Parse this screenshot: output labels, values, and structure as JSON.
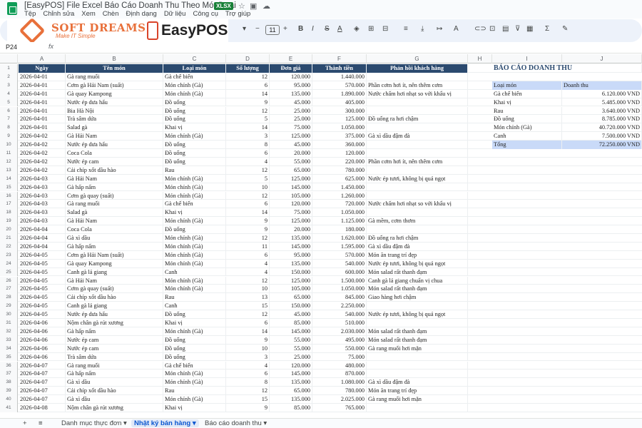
{
  "window": {
    "title": "[EasyPOS] File Excel Báo Cáo Doanh Thu Theo Món/Loại",
    "badge": "XLSX",
    "menus": [
      "Tệp",
      "Chỉnh sửa",
      "Xem",
      "Chèn",
      "Định dạng",
      "Dữ liệu",
      "Công cụ",
      "Trợ giúp"
    ]
  },
  "logos": {
    "brand1": "SOFT DREAMS",
    "slogan": "Make IT Simple",
    "brand2": "EasyPOS"
  },
  "toolbar": {
    "font_size": "11",
    "minus": "−",
    "plus": "+",
    "bold": "B",
    "italic": "I",
    "strike": "S",
    "textcolor": "A"
  },
  "formula": {
    "cell": "P24",
    "fx": "fx"
  },
  "columns": [
    "A",
    "B",
    "C",
    "D",
    "E",
    "F",
    "G",
    "H",
    "I",
    "J"
  ],
  "headers": [
    "Ngày",
    "Tên món",
    "Loại món",
    "Số lượng",
    "Đơn giá",
    "Thành tiền",
    "Phản hồi khách hàng"
  ],
  "rows": [
    [
      "2026-04-01",
      "Gà rang muối",
      "Gà chế biến",
      "12",
      "120.000",
      "1.440.000",
      ""
    ],
    [
      "2026-04-01",
      "Cơm gà Hải Nam (suất)",
      "Món chính (Gà)",
      "6",
      "95.000",
      "570.000",
      "Phần cơm hơi ít, nên thêm cơm"
    ],
    [
      "2026-04-01",
      "Gà quay Kampong",
      "Món chính (Gà)",
      "14",
      "135.000",
      "1.890.000",
      "Nước chấm hơi nhạt so với khẩu vị"
    ],
    [
      "2026-04-01",
      "Nước ép dưa hấu",
      "Đồ uống",
      "9",
      "45.000",
      "405.000",
      ""
    ],
    [
      "2026-04-01",
      "Bia Hà Nội",
      "Đồ uống",
      "12",
      "25.000",
      "300.000",
      ""
    ],
    [
      "2026-04-01",
      "Trà sâm dứa",
      "Đồ uống",
      "5",
      "25.000",
      "125.000",
      "Đồ uống ra hơi chậm"
    ],
    [
      "2026-04-01",
      "Salad gà",
      "Khai vị",
      "14",
      "75.000",
      "1.050.000",
      ""
    ],
    [
      "2026-04-02",
      "Gà Hải Nam",
      "Món chính (Gà)",
      "3",
      "125.000",
      "375.000",
      "Gà xì dầu đậm đà"
    ],
    [
      "2026-04-02",
      "Nước ép dưa hấu",
      "Đồ uống",
      "8",
      "45.000",
      "360.000",
      ""
    ],
    [
      "2026-04-02",
      "Coca Cola",
      "Đồ uống",
      "6",
      "20.000",
      "120.000",
      ""
    ],
    [
      "2026-04-02",
      "Nước ép cam",
      "Đồ uống",
      "4",
      "55.000",
      "220.000",
      "Phần cơm hơi ít, nên thêm cơm"
    ],
    [
      "2026-04-02",
      "Cải chíp xốt dầu hào",
      "Rau",
      "12",
      "65.000",
      "780.000",
      ""
    ],
    [
      "2026-04-03",
      "Gà Hải Nam",
      "Món chính (Gà)",
      "5",
      "125.000",
      "625.000",
      "Nước ép tươi, không bị quá ngọt"
    ],
    [
      "2026-04-03",
      "Gà hấp nấm",
      "Món chính (Gà)",
      "10",
      "145.000",
      "1.450.000",
      ""
    ],
    [
      "2026-04-03",
      "Cơm gà quay (suất)",
      "Món chính (Gà)",
      "12",
      "105.000",
      "1.260.000",
      ""
    ],
    [
      "2026-04-03",
      "Gà rang muối",
      "Gà chế biến",
      "6",
      "120.000",
      "720.000",
      "Nước chấm hơi nhạt so với khẩu vị"
    ],
    [
      "2026-04-03",
      "Salad gà",
      "Khai vị",
      "14",
      "75.000",
      "1.050.000",
      ""
    ],
    [
      "2026-04-03",
      "Gà Hải Nam",
      "Món chính (Gà)",
      "9",
      "125.000",
      "1.125.000",
      "Gà mềm, cơm thơm"
    ],
    [
      "2026-04-04",
      "Coca Cola",
      "Đồ uống",
      "9",
      "20.000",
      "180.000",
      ""
    ],
    [
      "2026-04-04",
      "Gà xì dầu",
      "Món chính (Gà)",
      "12",
      "135.000",
      "1.620.000",
      "Đồ uống ra hơi chậm"
    ],
    [
      "2026-04-04",
      "Gà hấp nấm",
      "Món chính (Gà)",
      "11",
      "145.000",
      "1.595.000",
      "Gà xì dầu đậm đà"
    ],
    [
      "2026-04-05",
      "Cơm gà Hải Nam (suất)",
      "Món chính (Gà)",
      "6",
      "95.000",
      "570.000",
      "Món ăn trang trí đẹp"
    ],
    [
      "2026-04-05",
      "Gà quay Kampong",
      "Món chính (Gà)",
      "4",
      "135.000",
      "540.000",
      "Nước ép tươi, không bị quá ngọt"
    ],
    [
      "2026-04-05",
      "Canh gà lá giang",
      "Canh",
      "4",
      "150.000",
      "600.000",
      "Món salad rất thanh đạm"
    ],
    [
      "2026-04-05",
      "Gà Hải Nam",
      "Món chính (Gà)",
      "12",
      "125.000",
      "1.500.000",
      "Canh gà lá giang chuẩn vị chua"
    ],
    [
      "2026-04-05",
      "Cơm gà quay (suất)",
      "Món chính (Gà)",
      "10",
      "105.000",
      "1.050.000",
      "Món salad rất thanh đạm"
    ],
    [
      "2026-04-05",
      "Cải chíp xốt dầu hào",
      "Rau",
      "13",
      "65.000",
      "845.000",
      "Giao hàng hơi chậm"
    ],
    [
      "2026-04-05",
      "Canh gà lá giang",
      "Canh",
      "15",
      "150.000",
      "2.250.000",
      ""
    ],
    [
      "2026-04-05",
      "Nước ép dưa hấu",
      "Đồ uống",
      "12",
      "45.000",
      "540.000",
      "Nước ép tươi, không bị quá ngọt"
    ],
    [
      "2026-04-06",
      "Nộm chân gà rút xương",
      "Khai vị",
      "6",
      "85.000",
      "510.000",
      ""
    ],
    [
      "2026-04-06",
      "Gà hấp nấm",
      "Món chính (Gà)",
      "14",
      "145.000",
      "2.030.000",
      "Món salad rất thanh đạm"
    ],
    [
      "2026-04-06",
      "Nước ép cam",
      "Đồ uống",
      "9",
      "55.000",
      "495.000",
      "Món salad rất thanh đạm"
    ],
    [
      "2026-04-06",
      "Nước ép cam",
      "Đồ uống",
      "10",
      "55.000",
      "550.000",
      "Gà rang muối hơi mặn"
    ],
    [
      "2026-04-06",
      "Trà sâm dứa",
      "Đồ uống",
      "3",
      "25.000",
      "75.000",
      ""
    ],
    [
      "2026-04-07",
      "Gà rang muối",
      "Gà chế biến",
      "4",
      "120.000",
      "480.000",
      ""
    ],
    [
      "2026-04-07",
      "Gà hấp nấm",
      "Món chính (Gà)",
      "6",
      "145.000",
      "870.000",
      ""
    ],
    [
      "2026-04-07",
      "Gà xì dầu",
      "Món chính (Gà)",
      "8",
      "135.000",
      "1.080.000",
      "Gà xì dầu đậm đà"
    ],
    [
      "2026-04-07",
      "Cải chíp xốt dầu hào",
      "Rau",
      "12",
      "65.000",
      "780.000",
      "Món ăn trang trí đẹp"
    ],
    [
      "2026-04-07",
      "Gà xì dầu",
      "Món chính (Gà)",
      "15",
      "135.000",
      "2.025.000",
      "Gà rang muối hơi mặn"
    ],
    [
      "2026-04-08",
      "Nộm chân gà rút xương",
      "Khai vị",
      "9",
      "85.000",
      "765.000",
      ""
    ]
  ],
  "report": {
    "title": "BÁO CÁO DOANH THU",
    "col1": "Loại món",
    "col2": "Doanh thu",
    "items": [
      [
        "Gà chế biến",
        "6.120.000 VND"
      ],
      [
        "Khai vị",
        "5.485.000 VND"
      ],
      [
        "Rau",
        "3.640.000 VND"
      ],
      [
        "Đồ uống",
        "8.785.000 VND"
      ],
      [
        "Món chính (Gà)",
        "40.720.000 VND"
      ],
      [
        "Canh",
        "7.500.000 VND"
      ]
    ],
    "total_label": "Tổng",
    "total_value": "72.250.000 VND"
  },
  "tabs": {
    "add": "+",
    "list": "≡",
    "items": [
      "Danh mục thực đơn",
      "Nhật ký bán hàng",
      "Báo cáo doanh thu"
    ],
    "active": 1
  }
}
